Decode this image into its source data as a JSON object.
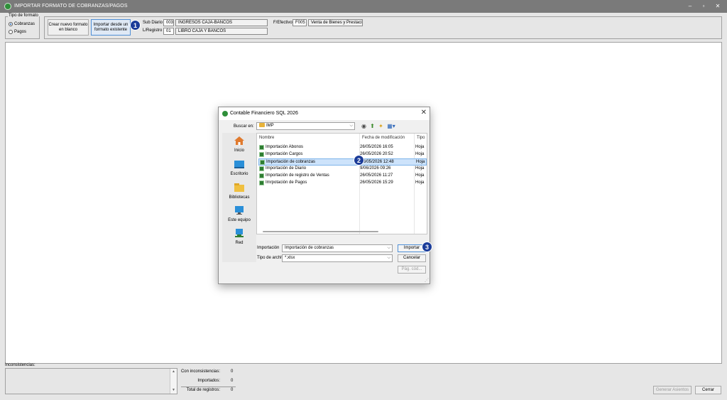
{
  "window": {
    "title": "IMPORTAR FORMATO DE COBRANZAS/PAGOS",
    "controls": [
      "–",
      "▫",
      "✕"
    ]
  },
  "tipo_formato": {
    "legend": "Tipo de formato",
    "options": [
      {
        "label": "Cobranzas",
        "selected": true
      },
      {
        "label": "Pagos",
        "selected": false
      }
    ]
  },
  "toolbar": {
    "new_format_line1": "Crear nuevo formato",
    "new_format_line2": "en blanco",
    "import_existing_line1": "Importar desde un",
    "import_existing_line2": "formato existente",
    "sub_diario_label": "Sub Diario",
    "sub_diario_code": "003",
    "sub_diario_name": "INGRESOS CAJA-BANCOS",
    "libro_label": "L/Registro",
    "libro_code": "01",
    "libro_name": "LIBRO CAJA Y BANCOS",
    "flujo_label": "F/Efectivo",
    "flujo_code": "F005",
    "flujo_name": "Venta de Bienes y Prestació"
  },
  "badges": {
    "one": "1",
    "two": "2",
    "three": "3"
  },
  "bottom": {
    "inconsistencias_label": "Inconsistencias:",
    "con_inconsistencias_label": "Con inconsistencias:",
    "con_inconsistencias_value": "0",
    "importados_label": "Importados:",
    "importados_value": "0",
    "total_label": "Total de registros:",
    "total_value": "0",
    "generar_button": "Generar Asientos",
    "cerrar_button": "Cerrar"
  },
  "dialog": {
    "title": "Contable Financiero SQL 2026",
    "look_in_label": "Buscar en:",
    "look_in_value": "IMP",
    "places": [
      "Inicio",
      "Escritorio",
      "Bibliotecas",
      "Este equipo",
      "Red"
    ],
    "columns": {
      "name": "Nombre",
      "date": "Fecha de modificación",
      "type": "Tipo"
    },
    "files": [
      {
        "name": "Importación Abonos",
        "date": "26/05/2026 16:05",
        "type": "Hoja"
      },
      {
        "name": "Importación Cargos",
        "date": "26/05/2026 20:52",
        "type": "Hoja"
      },
      {
        "name": "Importación de cobranzas",
        "date": "26/05/2026 12:48",
        "type": "Hoja"
      },
      {
        "name": "Importación de Diario",
        "date": "9/06/2026 09:26",
        "type": "Hoja"
      },
      {
        "name": "Importación de registro de Ventas",
        "date": "26/05/2026 11:27",
        "type": "Hoja"
      },
      {
        "name": "Imrpotación de Pagos",
        "date": "26/05/2026 15:29",
        "type": "Hoja"
      }
    ],
    "file_name_label": "Importación",
    "file_name_value": "Importación de cobranzas",
    "file_type_label": "Tipo de archivo",
    "file_type_value": "*.xlsx",
    "import_button": "Importar",
    "cancel_button": "Cancelar",
    "codepage_button": "Pág. cód..."
  }
}
